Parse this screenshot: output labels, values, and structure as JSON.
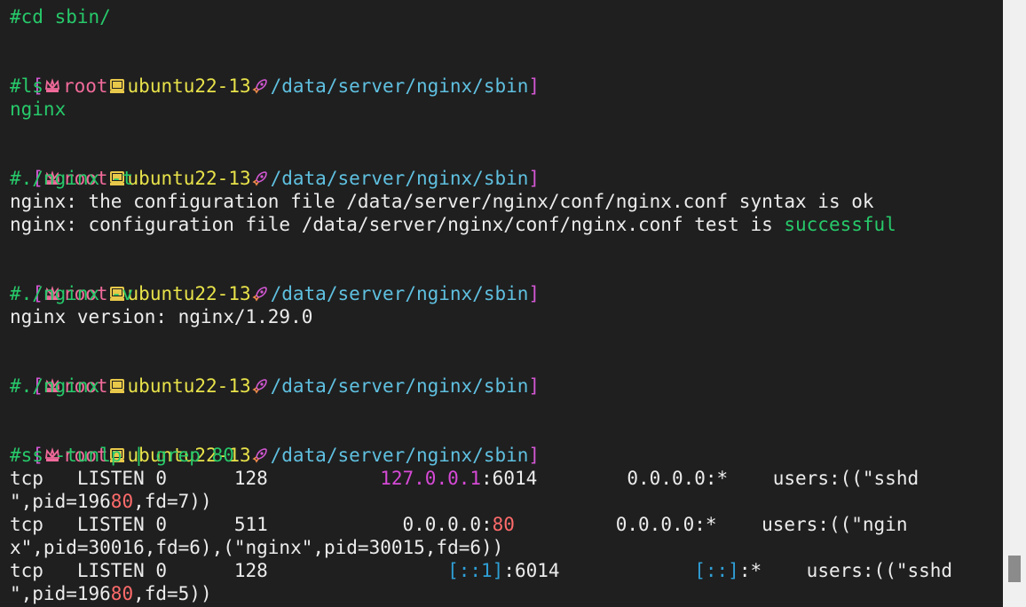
{
  "prompt": {
    "bracket_open": "[",
    "user": "root",
    "host": "ubuntu22-13",
    "path": "/data/server/nginx/sbin",
    "bracket_close": "]",
    "icons": [
      "crown-icon",
      "computer-icon",
      "rocket-icon"
    ]
  },
  "lines": {
    "l0_cmd": "#cd sbin/",
    "l2_cmd": "#ls",
    "l3_out": "nginx",
    "l5_cmd": "#./nginx -t",
    "l6_out": "nginx: the configuration file /data/server/nginx/conf/nginx.conf syntax is ok",
    "l7_out_a": "nginx: configuration file /data/server/nginx/conf/nginx.conf test is ",
    "l7_out_b": "successful",
    "l9_cmd": "#./nginx -v",
    "l10_out": "nginx version: nginx/1.29.0",
    "l12_cmd": "#./nginx",
    "l14_cmd": "#ss -tunlp | grep 80"
  },
  "ss_rows": [
    {
      "line1_a": "tcp   LISTEN 0      128          ",
      "addr": "127.0.0.1",
      "line1_b": ":6014        0.0.0.0:*    users:((\"sshd",
      "line2_a": "\",pid=196",
      "line2_hl": "80",
      "line2_b": ",fd=7))"
    },
    {
      "line1_a": "tcp   LISTEN 0      511            0.0.0.0:",
      "port": "80",
      "line1_b": "         0.0.0.0:*    users:((\"ngin",
      "line2": "x\",pid=30016,fd=6),(\"nginx\",pid=30015,fd=6))"
    },
    {
      "line1_a": "tcp   LISTEN 0      128                ",
      "addr": "[::1]",
      "line1_b": ":6014            ",
      "peer": "[::]",
      "line1_c": ":*    users:((\"sshd",
      "line2_a": "\",pid=196",
      "line2_hl": "80",
      "line2_b": ",fd=5))"
    }
  ],
  "colors": {
    "background": "#1f1f1f",
    "command": "#27c96a",
    "user": "#f06a9a",
    "host": "#e8e24a",
    "path": "#5fc0e0"
  }
}
